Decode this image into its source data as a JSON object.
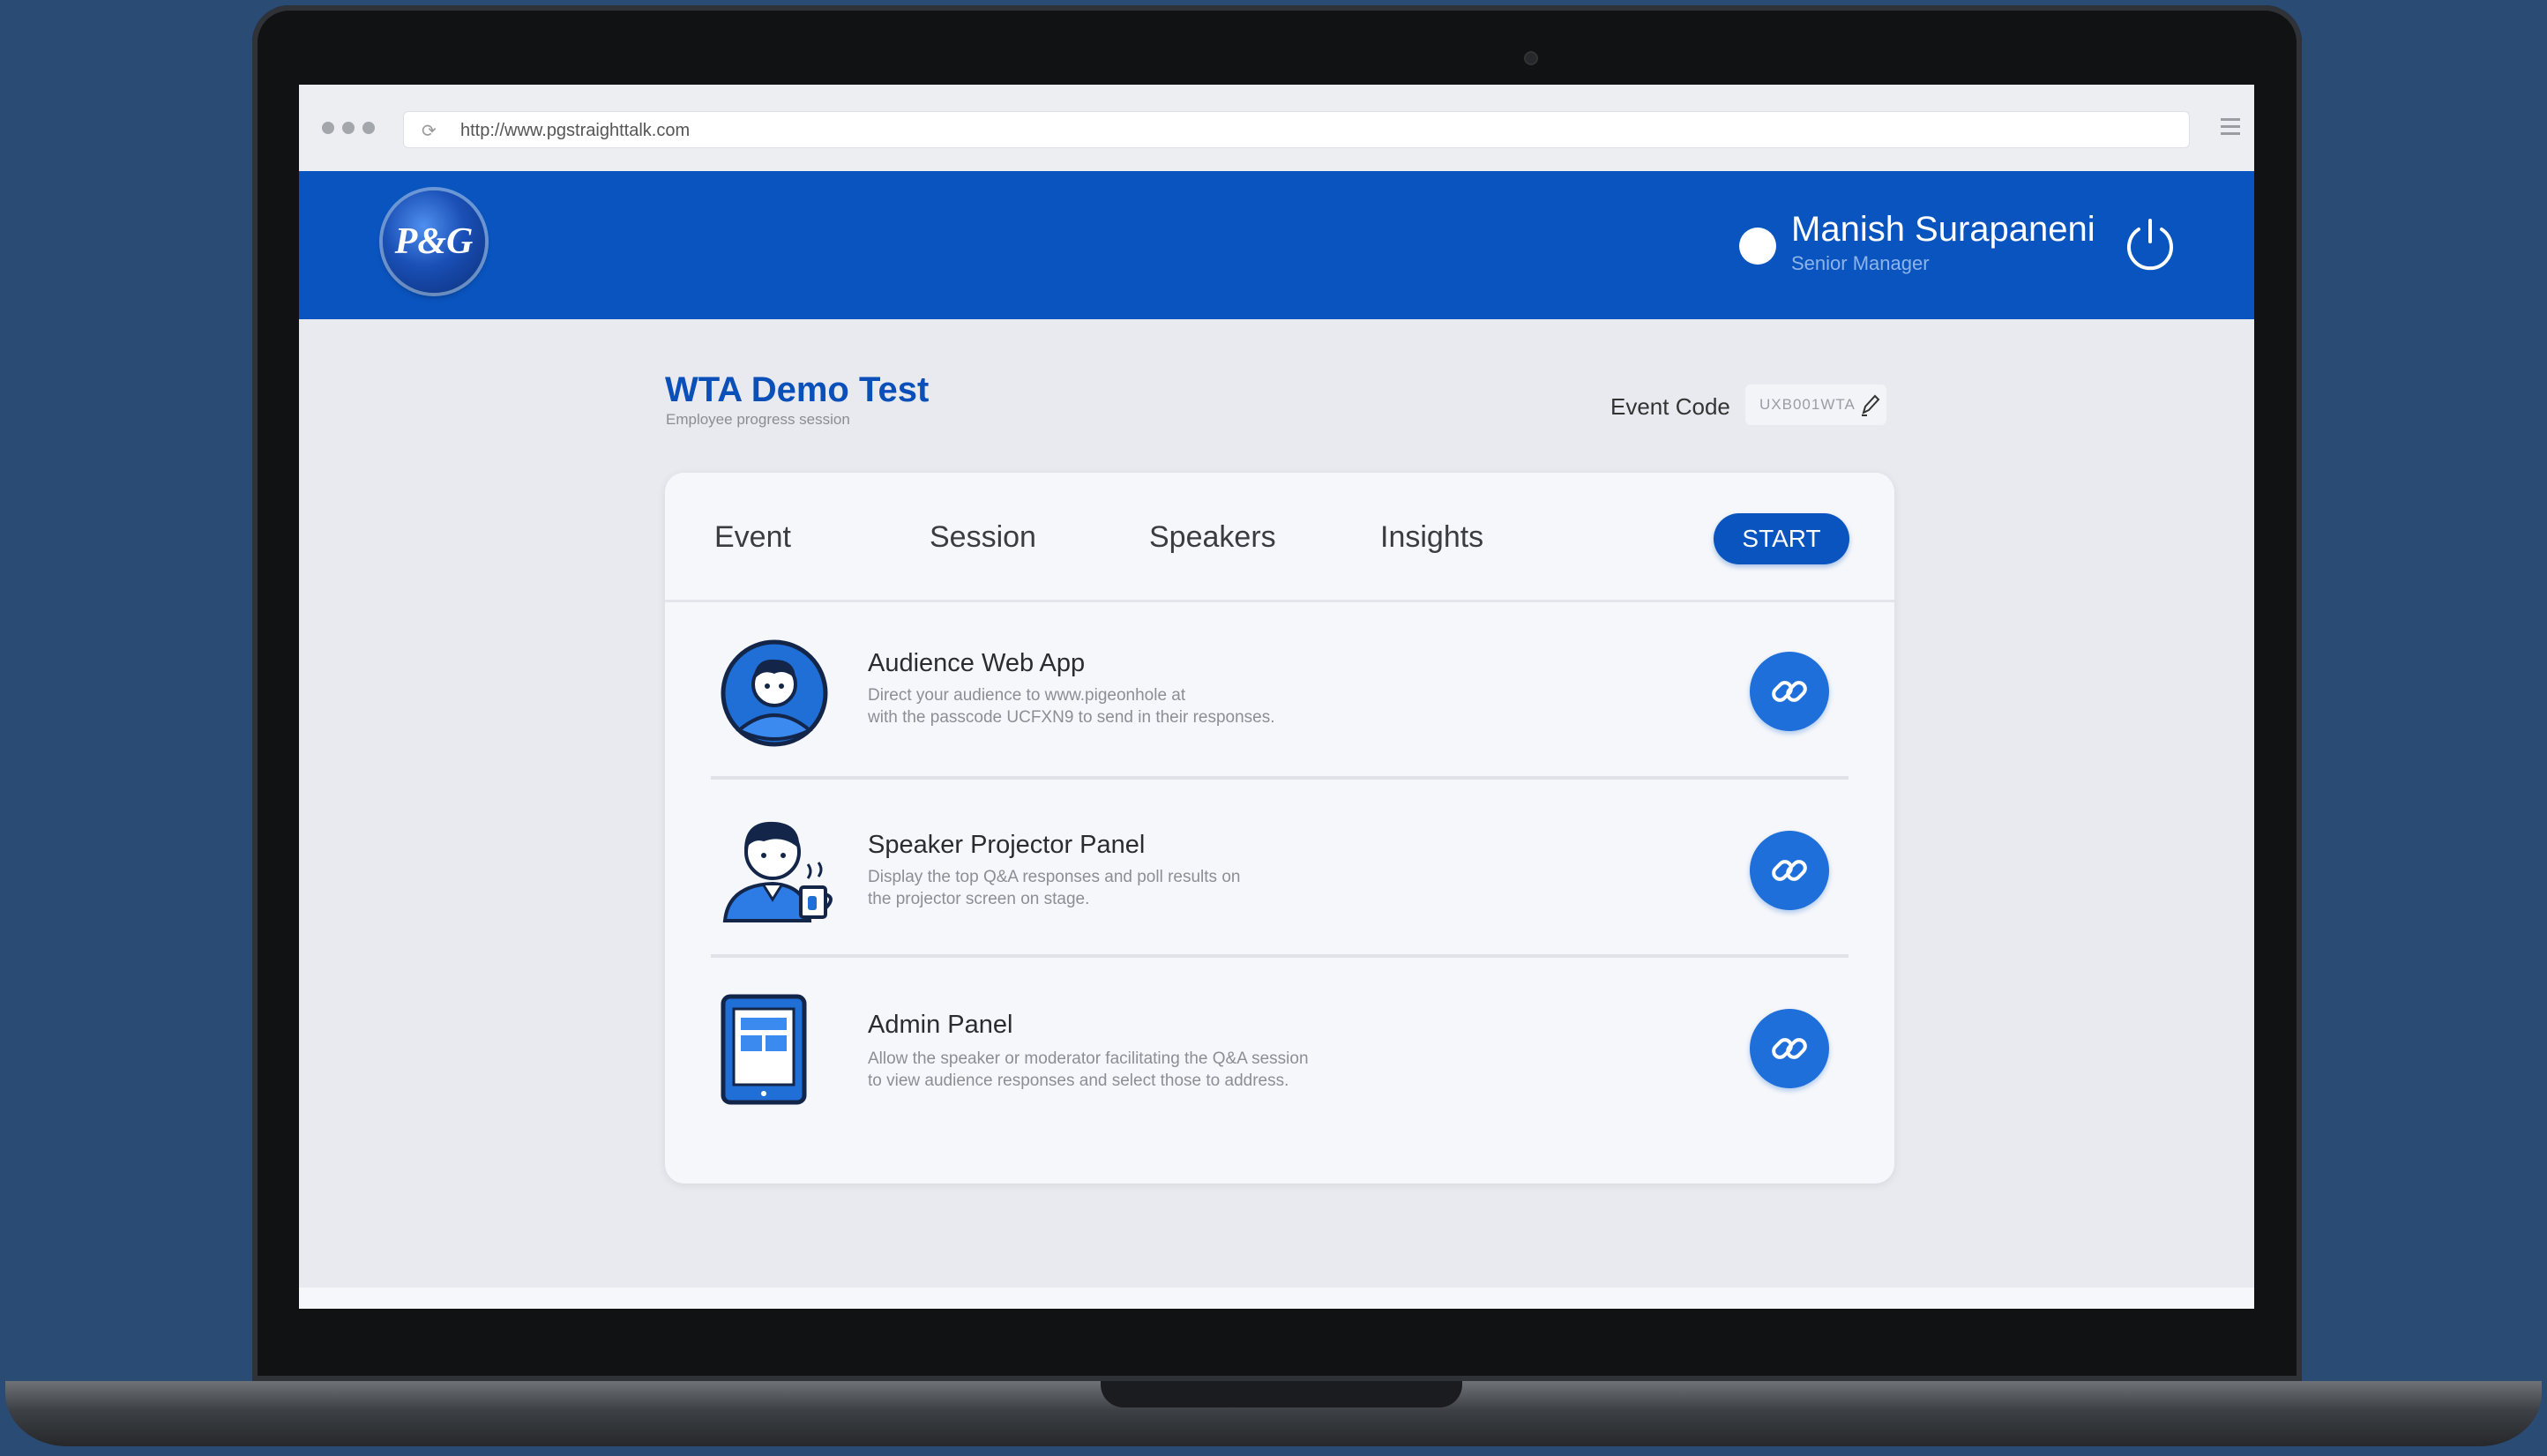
{
  "browser": {
    "url": "http://www.pgstraighttalk.com"
  },
  "header": {
    "logo_text": "P&G",
    "user_name": "Manish Surapaneni",
    "user_role": "Senior Manager"
  },
  "event": {
    "title": "WTA Demo Test",
    "subtitle": "Employee progress session",
    "code_label": "Event Code",
    "code_value": "UXB001WTA"
  },
  "tabs": [
    "Event",
    "Session",
    "Speakers",
    "Insights"
  ],
  "start_label": "START",
  "panels": [
    {
      "title": "Audience Web App",
      "desc_line1": "Direct your audience to www.pigeonhole at",
      "desc_line2": "with the passcode UCFXN9 to send in their responses.",
      "icon": "audience-avatar-icon"
    },
    {
      "title": "Speaker Projector Panel",
      "desc_line1": "Display the top Q&A responses and poll results on",
      "desc_line2": "the projector screen on stage.",
      "icon": "speaker-avatar-icon"
    },
    {
      "title": "Admin Panel",
      "desc_line1": "Allow the speaker or moderator facilitating the Q&A session",
      "desc_line2": "to view audience responses and select those to address.",
      "icon": "tablet-icon"
    }
  ],
  "colors": {
    "brand_blue": "#0a54bf",
    "link_blue": "#1e6fd9",
    "background": "#2a4b74"
  }
}
